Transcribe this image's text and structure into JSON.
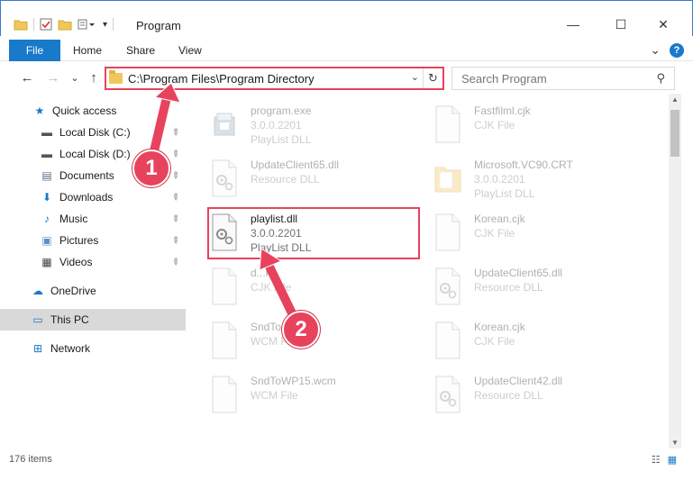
{
  "window": {
    "title": "Program",
    "minimize_glyph": "—",
    "maximize_glyph": "☐",
    "close_glyph": "✕"
  },
  "ribbon": {
    "tabs": [
      "File",
      "Home",
      "Share",
      "View"
    ],
    "expand_glyph": "⌄",
    "help_glyph": "?"
  },
  "nav": {
    "back_glyph": "←",
    "forward_glyph": "→",
    "recent_glyph": "⌄",
    "up_glyph": "↑",
    "address": "C:\\Program Files\\Program Directory",
    "address_dropdown_glyph": "⌄",
    "refresh_glyph": "↻",
    "search_placeholder": "Search Program",
    "search_glyph": "⚲"
  },
  "sidebar": {
    "items": [
      {
        "label": "Quick access",
        "icon": "star-icon",
        "glyph": "★",
        "color": "#1979ca",
        "pinned": false
      },
      {
        "label": "Local Disk (C:)",
        "icon": "drive-icon",
        "glyph": "▬",
        "color": "#555555",
        "pinned": true
      },
      {
        "label": "Local Disk (D:)",
        "icon": "drive-icon",
        "glyph": "▬",
        "color": "#555555",
        "pinned": true
      },
      {
        "label": "Documents",
        "icon": "documents-icon",
        "glyph": "▤",
        "color": "#5b6f8a",
        "pinned": true
      },
      {
        "label": "Downloads",
        "icon": "download-icon",
        "glyph": "⬇",
        "color": "#1979ca",
        "pinned": true
      },
      {
        "label": "Music",
        "icon": "music-icon",
        "glyph": "♪",
        "color": "#1979ca",
        "pinned": true
      },
      {
        "label": "Pictures",
        "icon": "pictures-icon",
        "glyph": "▣",
        "color": "#5b8fc7",
        "pinned": true
      },
      {
        "label": "Videos",
        "icon": "videos-icon",
        "glyph": "▦",
        "color": "#444444",
        "pinned": true
      },
      {
        "label": "OneDrive",
        "icon": "cloud-icon",
        "glyph": "☁",
        "color": "#1979ca",
        "pinned": false
      },
      {
        "label": "This PC",
        "icon": "computer-icon",
        "glyph": "▭",
        "color": "#1979ca",
        "pinned": false
      },
      {
        "label": "Network",
        "icon": "network-icon",
        "glyph": "⊞",
        "color": "#1979ca",
        "pinned": false
      }
    ],
    "pin_glyph": "📌"
  },
  "files": [
    {
      "name": "program.exe",
      "line2": "3.0.0.2201",
      "line3": "PlayList DLL",
      "type": "exe"
    },
    {
      "name": "Fastfilml.cjk",
      "line2": "CJK File",
      "line3": "",
      "type": "blank"
    },
    {
      "name": "UpdateClient65.dll",
      "line2": "Resource DLL",
      "line3": "",
      "type": "dll"
    },
    {
      "name": "Microsoft.VC90.CRT",
      "line2": "3.0.0.2201",
      "line3": "PlayList DLL",
      "type": "folder"
    },
    {
      "name": "playlist.dll",
      "line2": "3.0.0.2201",
      "line3": "PlayList DLL",
      "type": "dll"
    },
    {
      "name": "Korean.cjk",
      "line2": "CJK File",
      "line3": "",
      "type": "blank"
    },
    {
      "name": "d...k",
      "line2": "CJK File",
      "line3": "",
      "type": "blank"
    },
    {
      "name": "UpdateClient65.dll",
      "line2": "Resource DLL",
      "line3": "",
      "type": "dll"
    },
    {
      "name": "SndTo...wcm",
      "line2": "WCM File",
      "line3": "",
      "type": "blank"
    },
    {
      "name": "Korean.cjk",
      "line2": "CJK File",
      "line3": "",
      "type": "blank"
    },
    {
      "name": "SndToWP15.wcm",
      "line2": "WCM File",
      "line3": "",
      "type": "blank"
    },
    {
      "name": "UpdateClient42.dll",
      "line2": "Resource DLL",
      "line3": "",
      "type": "dll"
    }
  ],
  "annotations": {
    "badge_1": "1",
    "badge_2": "2",
    "color": "#e8435c"
  },
  "status": {
    "item_count": "176 items",
    "details_view_glyph": "☷",
    "icons_view_glyph": "▦"
  }
}
